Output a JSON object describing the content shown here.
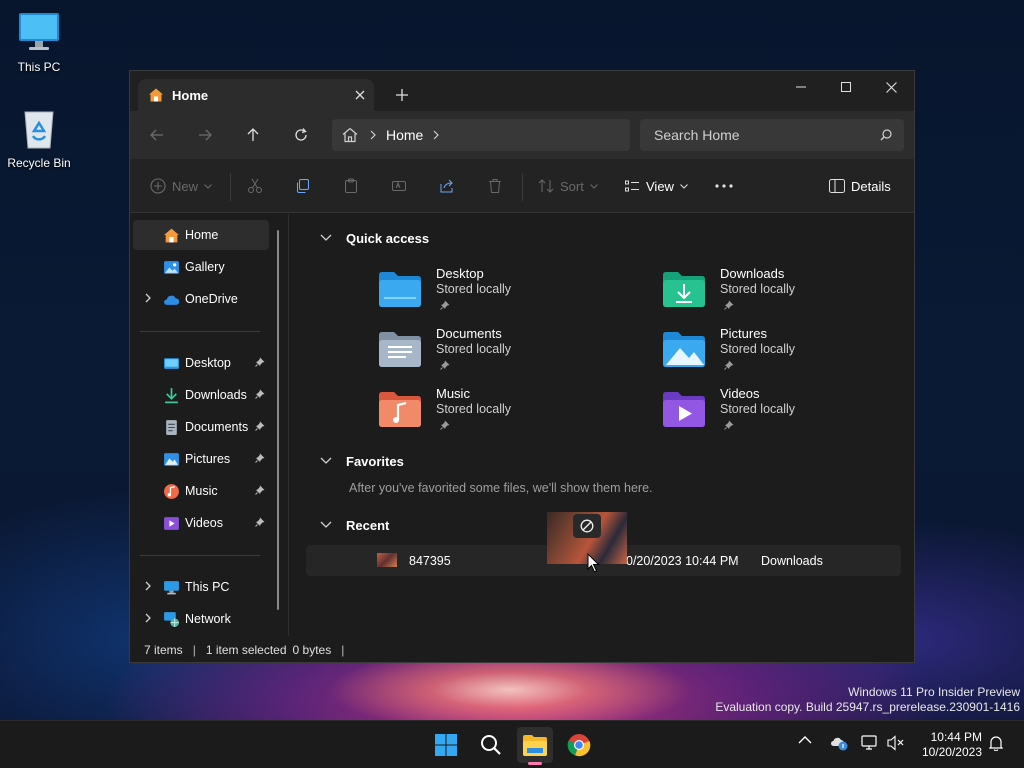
{
  "desktop": {
    "icons": [
      {
        "label": "This PC",
        "icon": "monitor-icon"
      },
      {
        "label": "Recycle Bin",
        "icon": "recycle-bin-icon"
      }
    ]
  },
  "window": {
    "tab_title": "Home",
    "address_crumb": "Home",
    "search_placeholder": "Search Home",
    "toolbar": {
      "new_label": "New",
      "sort_label": "Sort",
      "view_label": "View",
      "details_label": "Details"
    },
    "sidebar": {
      "items": [
        {
          "label": "Home",
          "icon": "home-icon",
          "active": true
        },
        {
          "label": "Gallery",
          "icon": "gallery-icon"
        },
        {
          "label": "OneDrive",
          "icon": "cloud-icon",
          "expandable": true
        },
        {
          "label": "Desktop",
          "icon": "desktop-folder-icon",
          "pinned": true
        },
        {
          "label": "Downloads",
          "icon": "download-icon",
          "pinned": true
        },
        {
          "label": "Documents",
          "icon": "documents-icon",
          "pinned": true
        },
        {
          "label": "Pictures",
          "icon": "pictures-icon",
          "pinned": true
        },
        {
          "label": "Music",
          "icon": "music-icon",
          "pinned": true
        },
        {
          "label": "Videos",
          "icon": "videos-icon",
          "pinned": true
        },
        {
          "label": "This PC",
          "icon": "this-pc-icon",
          "expandable": true
        },
        {
          "label": "Network",
          "icon": "network-icon",
          "expandable": true
        }
      ]
    },
    "sections": {
      "quick_access": "Quick access",
      "favorites": "Favorites",
      "favorites_empty": "After you've favorited some files, we'll show them here.",
      "recent": "Recent"
    },
    "quick_access": [
      {
        "name": "Desktop",
        "status": "Stored locally",
        "icon": "desktop-folder-icon"
      },
      {
        "name": "Downloads",
        "status": "Stored locally",
        "icon": "downloads-folder-icon"
      },
      {
        "name": "Documents",
        "status": "Stored locally",
        "icon": "documents-folder-icon"
      },
      {
        "name": "Pictures",
        "status": "Stored locally",
        "icon": "pictures-folder-icon"
      },
      {
        "name": "Music",
        "status": "Stored locally",
        "icon": "music-folder-icon"
      },
      {
        "name": "Videos",
        "status": "Stored locally",
        "icon": "videos-folder-icon"
      }
    ],
    "recent": [
      {
        "name": "847395",
        "date": "0/20/2023 10:44 PM",
        "location": "Downloads"
      }
    ],
    "status": {
      "items": "7 items",
      "selected": "1 item selected",
      "size": "0 bytes"
    }
  },
  "watermark": {
    "line1": "Windows 11 Pro Insider Preview",
    "line2": "Evaluation copy. Build 25947.rs_prerelease.230901-1416"
  },
  "taskbar": {
    "apps": [
      "start-icon",
      "search-icon",
      "file-explorer-icon",
      "chrome-icon"
    ],
    "time": "10:44 PM",
    "date": "10/20/2023"
  },
  "colors": {
    "window_bg": "#1c1c1c",
    "accent_pink": "#ff7ab0",
    "folder_blue": "#3aa0e8"
  }
}
